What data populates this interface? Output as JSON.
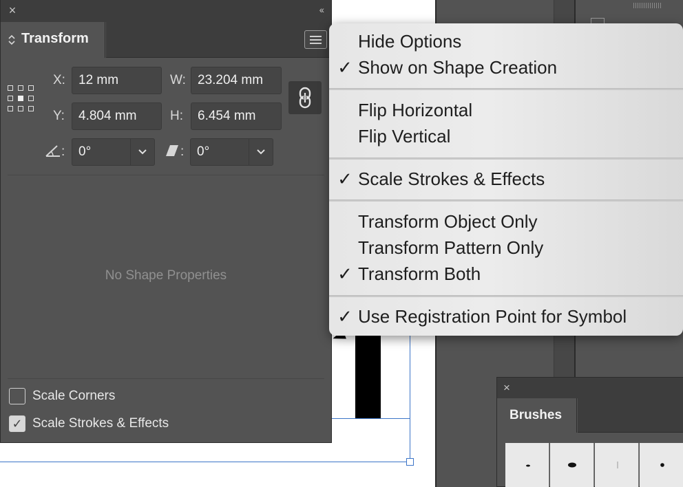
{
  "panel": {
    "close_glyph": "×",
    "collapse_glyph": "‹‹",
    "tab_title": "Transform",
    "fields": {
      "x_label": "X:",
      "x_value": "12 mm",
      "w_label": "W:",
      "w_value": "23.204 mm",
      "y_label": "Y:",
      "y_value": "4.804 mm",
      "h_label": "H:",
      "h_value": "6.454 mm",
      "rotate_value": "0°",
      "shear_value": "0°"
    },
    "colon": ":",
    "no_shape_text": "No Shape Properties",
    "scale_corners_label": "Scale Corners",
    "scale_corners_checked": false,
    "scale_strokes_label": "Scale Strokes & Effects",
    "scale_strokes_checked": true
  },
  "flyout_menu": {
    "items": [
      {
        "label": "Hide Options",
        "checked": false
      },
      {
        "label": "Show on Shape Creation",
        "checked": true
      },
      {
        "label": "Flip Horizontal",
        "checked": false
      },
      {
        "label": "Flip Vertical",
        "checked": false
      },
      {
        "label": "Scale Strokes & Effects",
        "checked": true
      },
      {
        "label": "Transform Object Only",
        "checked": false
      },
      {
        "label": "Transform Pattern Only",
        "checked": false
      },
      {
        "label": "Transform Both",
        "checked": true
      },
      {
        "label": "Use Registration Point for Symbol",
        "checked": true
      }
    ],
    "check_glyph": "✓"
  },
  "brushes_panel": {
    "close_glyph": "×",
    "tab_title": "Brushes"
  },
  "icons": {
    "panel_menu": "hamburger-menu-icon",
    "constrain": "link-chain-icon",
    "rotate": "rotate-angle-icon",
    "shear": "shear-icon",
    "reference_point": "reference-point-grid-icon",
    "dropdown": "chevron-down-icon"
  },
  "colors": {
    "panel_bg": "#535353",
    "panel_dark": "#3d3d3d",
    "selection_blue": "#3b74c7",
    "menu_bg": "#e6e6e6"
  }
}
